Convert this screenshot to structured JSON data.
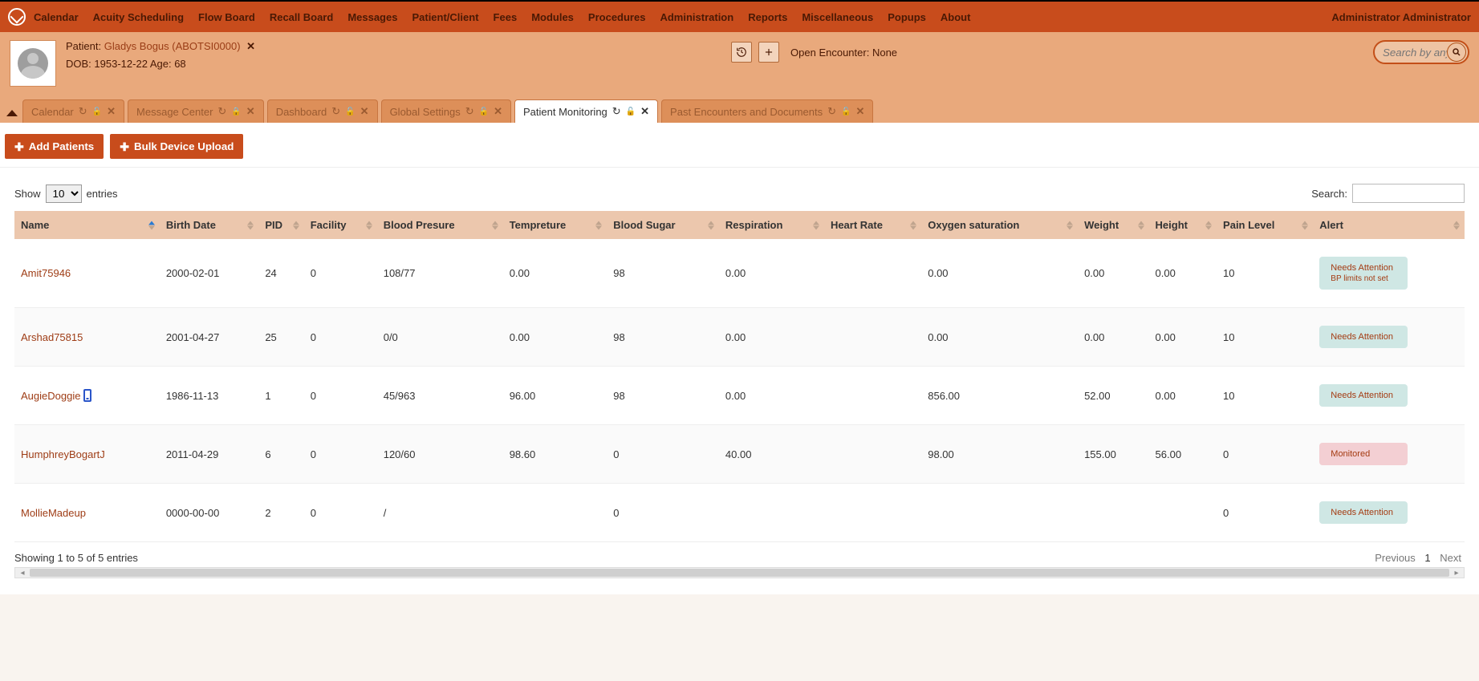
{
  "nav": {
    "items": [
      "Calendar",
      "Acuity Scheduling",
      "Flow Board",
      "Recall Board",
      "Messages",
      "Patient/Client",
      "Fees",
      "Modules",
      "Procedures",
      "Administration",
      "Reports",
      "Miscellaneous",
      "Popups",
      "About"
    ],
    "user": "Administrator Administrator"
  },
  "patient": {
    "prefix": "Patient:",
    "name": "Gladys Bogus (ABOTSI0000)",
    "clear": "✕",
    "dob_label": "DOB:",
    "dob": "1953-12-22",
    "age_label": "Age:",
    "age": "68",
    "open_enc_label": "Open Encounter:",
    "open_enc_value": "None",
    "history_icon": "history-icon",
    "add_icon": "plus-icon",
    "search_placeholder": "Search by any de"
  },
  "tabs": [
    {
      "label": "Calendar",
      "active": false,
      "locked": false
    },
    {
      "label": "Message Center",
      "active": false,
      "locked": true
    },
    {
      "label": "Dashboard",
      "active": false,
      "locked": false
    },
    {
      "label": "Global Settings",
      "active": false,
      "locked": false
    },
    {
      "label": "Patient Monitoring",
      "active": true,
      "locked": false
    },
    {
      "label": "Past Encounters and Documents",
      "active": false,
      "locked": false
    }
  ],
  "actions": {
    "add_patients": "Add Patients",
    "bulk_upload": "Bulk Device Upload"
  },
  "table": {
    "show_label": "Show",
    "entries_label": "entries",
    "page_size": "10",
    "search_label": "Search:",
    "columns": [
      "Name",
      "Birth Date",
      "PID",
      "Facility",
      "Blood Presure",
      "Tempreture",
      "Blood Sugar",
      "Respiration",
      "Heart Rate",
      "Oxygen saturation",
      "Weight",
      "Height",
      "Pain Level",
      "Alert"
    ],
    "rows": [
      {
        "name": "Amit75946",
        "mobile": false,
        "birth": "2000-02-01",
        "pid": "24",
        "facility": "0",
        "bp": "108/77",
        "temp": "0.00",
        "sugar": "98",
        "resp": "0.00",
        "hr": "",
        "o2": "0.00",
        "weight": "0.00",
        "height": "0.00",
        "pain": "10",
        "alert": {
          "text": "Needs Attention",
          "sub": "BP limits not set",
          "type": "needs"
        }
      },
      {
        "name": "Arshad75815",
        "mobile": false,
        "birth": "2001-04-27",
        "pid": "25",
        "facility": "0",
        "bp": "0/0",
        "temp": "0.00",
        "sugar": "98",
        "resp": "0.00",
        "hr": "",
        "o2": "0.00",
        "weight": "0.00",
        "height": "0.00",
        "pain": "10",
        "alert": {
          "text": "Needs Attention",
          "sub": "",
          "type": "needs"
        }
      },
      {
        "name": "AugieDoggie",
        "mobile": true,
        "birth": "1986-11-13",
        "pid": "1",
        "facility": "0",
        "bp": "45/963",
        "temp": "96.00",
        "sugar": "98",
        "resp": "0.00",
        "hr": "",
        "o2": "856.00",
        "weight": "52.00",
        "height": "0.00",
        "pain": "10",
        "alert": {
          "text": "Needs Attention",
          "sub": "",
          "type": "needs"
        }
      },
      {
        "name": "HumphreyBogartJ",
        "mobile": false,
        "birth": "2011-04-29",
        "pid": "6",
        "facility": "0",
        "bp": "120/60",
        "temp": "98.60",
        "sugar": "0",
        "resp": "40.00",
        "hr": "",
        "o2": "98.00",
        "weight": "155.00",
        "height": "56.00",
        "pain": "0",
        "alert": {
          "text": "Monitored",
          "sub": "",
          "type": "mon"
        }
      },
      {
        "name": "MollieMadeup",
        "mobile": false,
        "birth": "0000-00-00",
        "pid": "2",
        "facility": "0",
        "bp": "/",
        "temp": "",
        "sugar": "0",
        "resp": "",
        "hr": "",
        "o2": "",
        "weight": "",
        "height": "",
        "pain": "0",
        "alert": {
          "text": "Needs Attention",
          "sub": "",
          "type": "needs"
        }
      }
    ],
    "info": "Showing 1 to 5 of 5 entries",
    "pager": {
      "prev": "Previous",
      "page": "1",
      "next": "Next"
    }
  }
}
